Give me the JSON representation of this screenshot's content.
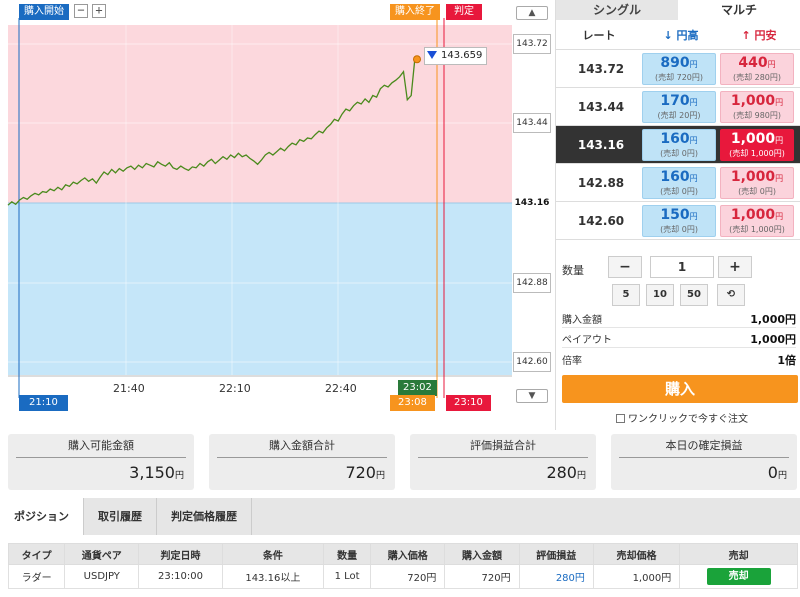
{
  "chart": {
    "start_tag": "購入開始",
    "end_tag": "購入終了",
    "judge_tag": "判定",
    "zoom_out": "−",
    "zoom_in": "+",
    "current_price": "143.659",
    "x_ticks": [
      "21:40",
      "22:10",
      "22:40"
    ],
    "start_time": "21:10",
    "current_time": "23:02",
    "end_time": "23:08",
    "judge_time": "23:10",
    "rates": [
      "143.72",
      "143.44",
      "143.16",
      "142.88",
      "142.60"
    ],
    "current_rate": "143.16",
    "colors": {
      "upper_zone": "#fcd8dd",
      "lower_zone": "#c5e6f9",
      "line": "#4a8a1c",
      "start": "#1a6bc1",
      "end": "#f7941e",
      "judge": "#e8183c",
      "now": "#2a7a3a"
    },
    "series": [
      0.01,
      0.05,
      0.02,
      0.07,
      0.1,
      0.08,
      0.12,
      0.15,
      0.13,
      0.17,
      0.16,
      0.2,
      0.18,
      0.22,
      0.19,
      0.25,
      0.23,
      0.28,
      0.26,
      0.3,
      0.33,
      0.29,
      0.32,
      0.27,
      0.34,
      0.4,
      0.37,
      0.43,
      0.39,
      0.44,
      0.41,
      0.45,
      0.47,
      0.43,
      0.48,
      0.45,
      0.5,
      0.48,
      0.46,
      0.52,
      0.49,
      0.47,
      0.51,
      0.45,
      0.43,
      0.47,
      0.44,
      0.42,
      0.46,
      0.45,
      0.5,
      0.47,
      0.52,
      0.55,
      0.5,
      0.54,
      0.58,
      0.55,
      0.6,
      0.57,
      0.62,
      0.58,
      0.6,
      0.56,
      0.53,
      0.49,
      0.54,
      0.6,
      0.63,
      0.6,
      0.64,
      0.68,
      0.65,
      0.7,
      0.74,
      0.72,
      0.78,
      0.76,
      0.8,
      0.79,
      0.84,
      0.88,
      0.86,
      0.92,
      0.96,
      1.02,
      1.0,
      1.08,
      1.14,
      1.12,
      1.18,
      1.22,
      1.2,
      1.26,
      1.22,
      1.3,
      1.28,
      1.38,
      1.42,
      1.4,
      1.45,
      1.48,
      1.52,
      1.58,
      1.25,
      1.3,
      1.75
    ]
  },
  "panel": {
    "tab_single": "シングル",
    "tab_multi": "マルチ",
    "head_rate": "レート",
    "head_up": "円高",
    "head_down": "円安",
    "rows": [
      {
        "rate": "143.72",
        "up_amt": "890",
        "up_sub": "(売却 720円)",
        "down_amt": "440",
        "down_sub": "(売却 280円)"
      },
      {
        "rate": "143.44",
        "up_amt": "170",
        "up_sub": "(売却 20円)",
        "down_amt": "1,000",
        "down_sub": "(売却 980円)"
      },
      {
        "rate": "143.16",
        "up_amt": "160",
        "up_sub": "(売却 0円)",
        "down_amt": "1,000",
        "down_sub": "(売却 1,000円)"
      },
      {
        "rate": "142.88",
        "up_amt": "160",
        "up_sub": "(売却 0円)",
        "down_amt": "1,000",
        "down_sub": "(売却 0円)"
      },
      {
        "rate": "142.60",
        "up_amt": "150",
        "up_sub": "(売却 0円)",
        "down_amt": "1,000",
        "down_sub": "(売却 1,000円)"
      }
    ],
    "yen": "円",
    "qty_label": "数量",
    "qty_minus": "−",
    "qty_value": "1",
    "qty_plus": "+",
    "quick": [
      "5",
      "10",
      "50"
    ],
    "reset": "⟲",
    "purchase_amount_label": "購入金額",
    "purchase_amount_value": "1,000円",
    "payout_label": "ペイアウト",
    "payout_value": "1,000円",
    "multiplier_label": "倍率",
    "multiplier_value": "1倍",
    "buy": "購入",
    "oneclick": "ワンクリックで今すぐ注文"
  },
  "summary": [
    {
      "label": "購入可能金額",
      "value": "3,150",
      "unit": "円"
    },
    {
      "label": "購入金額合計",
      "value": "720",
      "unit": "円"
    },
    {
      "label": "評価損益合計",
      "value": "280",
      "unit": "円"
    },
    {
      "label": "本日の確定損益",
      "value": "0",
      "unit": "円"
    }
  ],
  "bottom_tabs": [
    "ポジション",
    "取引履歴",
    "判定価格履歴"
  ],
  "positions": {
    "headers": [
      "タイプ",
      "通貨ペア",
      "判定日時",
      "条件",
      "数量",
      "購入価格",
      "購入金額",
      "評価損益",
      "売却価格",
      "売却"
    ],
    "rows": [
      {
        "type": "ラダー",
        "pair": "USDJPY",
        "time": "23:10:00",
        "cond": "143.16以上",
        "qty": "1 Lot",
        "price": "720円",
        "amount": "720円",
        "pl": "280円",
        "sell_price": "1,000円",
        "sell": "売却"
      }
    ]
  }
}
